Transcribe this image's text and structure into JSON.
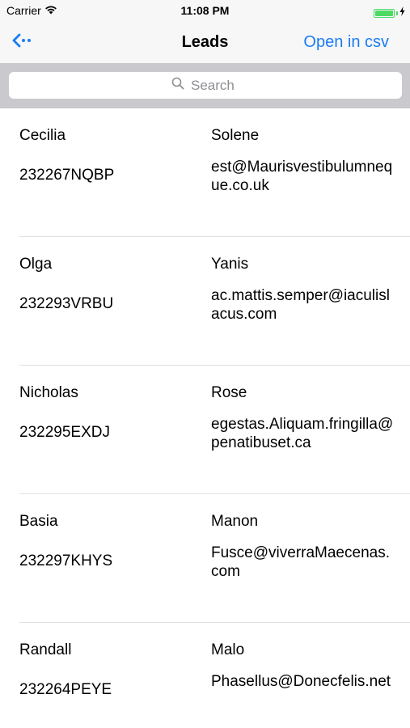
{
  "status_bar": {
    "carrier": "Carrier",
    "time": "11:08 PM",
    "battery_level": 1.0
  },
  "nav": {
    "back_icon": "back-arrow-icon",
    "title": "Leads",
    "right_button": "Open in csv"
  },
  "search": {
    "placeholder": "Search",
    "icon": "search-icon"
  },
  "colors": {
    "accent": "#1b7cf5",
    "battery": "#4cd964",
    "search_bar_bg": "#c9c9ce"
  },
  "leads": [
    {
      "first_name": "Cecilia",
      "last_name": "Solene",
      "id": "232267NQBP",
      "email": "est@Maurisvestibulumneque.co.uk"
    },
    {
      "first_name": "Olga",
      "last_name": "Yanis",
      "id": "232293VRBU",
      "email": "ac.mattis.semper@iaculislacus.com"
    },
    {
      "first_name": "Nicholas",
      "last_name": "Rose",
      "id": "232295EXDJ",
      "email": "egestas.Aliquam.fringilla@penatibuset.ca"
    },
    {
      "first_name": "Basia",
      "last_name": "Manon",
      "id": "232297KHYS",
      "email": "Fusce@viverraMaecenas.com"
    },
    {
      "first_name": "Randall",
      "last_name": "Malo",
      "id": "232264PEYE",
      "email": "Phasellus@Donecfelis.net"
    }
  ]
}
